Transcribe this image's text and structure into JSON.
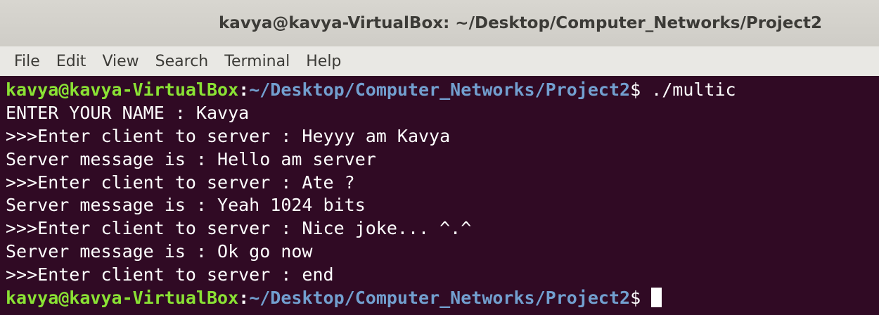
{
  "window": {
    "title": "kavya@kavya-VirtualBox: ~/Desktop/Computer_Networks/Project2"
  },
  "menu": {
    "items": [
      "File",
      "Edit",
      "View",
      "Search",
      "Terminal",
      "Help"
    ]
  },
  "terminal": {
    "prompt": {
      "user_host": "kavya@kavya-VirtualBox",
      "separator": ":",
      "path": "~/Desktop/Computer_Networks/Project2",
      "symbol": "$"
    },
    "command": " ./multic",
    "output_lines": [
      "ENTER YOUR NAME : Kavya",
      ">>>Enter client to server : Heyyy am Kavya",
      "Server message is : Hello am server",
      ">>>Enter client to server : Ate ?",
      "Server message is : Yeah 1024 bits",
      ">>>Enter client to server : Nice joke... ^.^",
      "Server message is : Ok go now",
      ">>>Enter client to server : end"
    ],
    "colors": {
      "background": "#300a24",
      "user_host": "#8ae234",
      "path": "#729fcf",
      "text": "#ffffff"
    }
  }
}
